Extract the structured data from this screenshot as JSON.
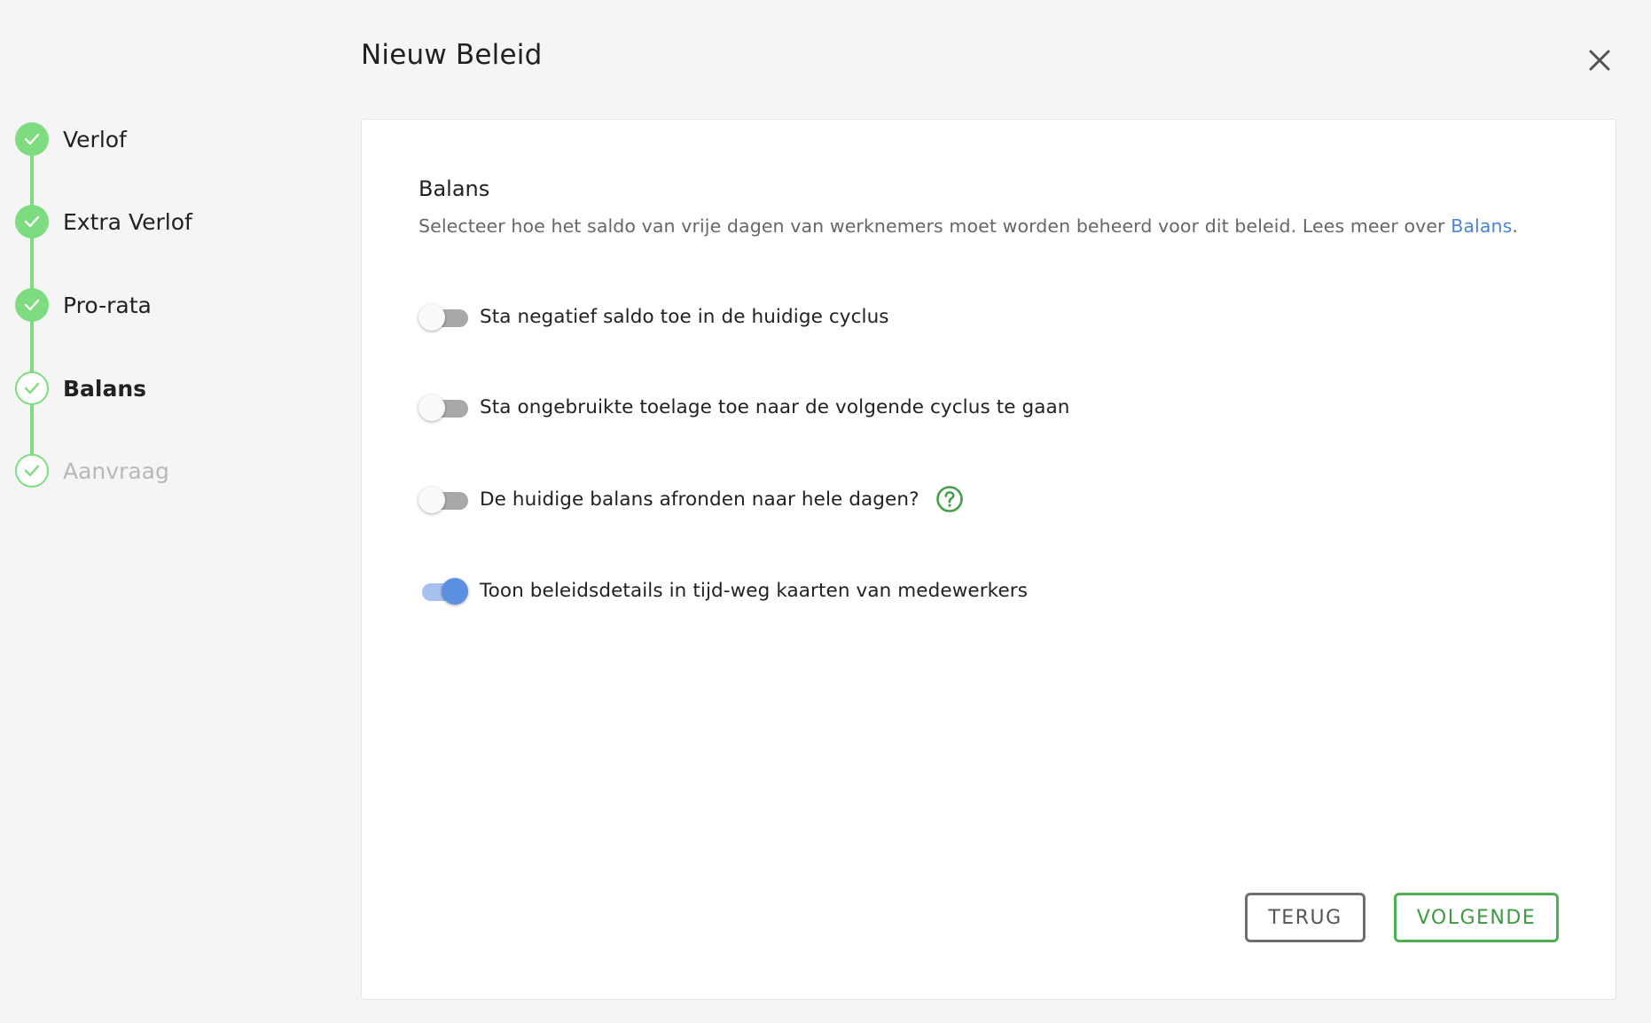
{
  "header": {
    "title": "Nieuw Beleid",
    "close_icon": "close-icon"
  },
  "stepper": {
    "steps": [
      {
        "label": "Verlof",
        "status": "done"
      },
      {
        "label": "Extra Verlof",
        "status": "done"
      },
      {
        "label": "Pro-rata",
        "status": "done"
      },
      {
        "label": "Balans",
        "status": "current"
      },
      {
        "label": "Aanvraag",
        "status": "pending"
      }
    ]
  },
  "card": {
    "title": "Balans",
    "description": "Selecteer hoe het saldo van vrije dagen van werknemers moet worden beheerd voor dit beleid. Lees meer over ",
    "description_link": "Balans",
    "description_suffix": ".",
    "toggles": [
      {
        "label": "Sta negatief saldo toe in de huidige cyclus",
        "on": false
      },
      {
        "label": "Sta ongebruikte toelage toe naar de volgende cyclus te gaan",
        "on": false
      },
      {
        "label": "De huidige balans afronden naar hele dagen?",
        "on": false,
        "help": true
      },
      {
        "label": "Toon beleidsdetails in tijd-weg kaarten van medewerkers",
        "on": true
      }
    ],
    "back_label": "TERUG",
    "next_label": "VOLGENDE"
  },
  "colors": {
    "page_bg": "#f5f5f5",
    "step_green": "#7ddc7f",
    "link_blue": "#4a84d6",
    "toggle_on": "#5b8fe0",
    "primary_green": "#4caf50"
  }
}
